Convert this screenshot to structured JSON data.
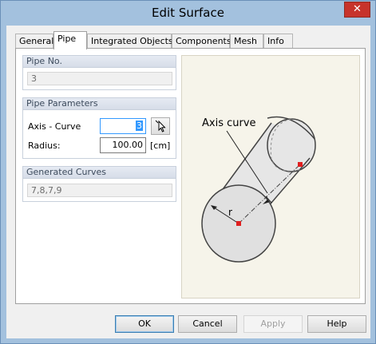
{
  "window": {
    "title": "Edit Surface",
    "close_glyph": "✕"
  },
  "tabs": [
    {
      "label": "General",
      "active": false
    },
    {
      "label": "Pipe",
      "active": true
    },
    {
      "label": "Integrated Objects",
      "active": false
    },
    {
      "label": "Components",
      "active": false
    },
    {
      "label": "Mesh",
      "active": false
    },
    {
      "label": "Info",
      "active": false
    }
  ],
  "pipe_no": {
    "header": "Pipe No.",
    "value": "3"
  },
  "pipe_parameters": {
    "header": "Pipe Parameters",
    "axis_curve_label": "Axis - Curve",
    "axis_curve_value": "3",
    "radius_label": "Radius:",
    "radius_value": "100.00",
    "radius_unit": "[cm]"
  },
  "generated_curves": {
    "header": "Generated Curves",
    "value": "7,8,7,9"
  },
  "illustration": {
    "axis_label": "Axis curve",
    "radius_label": "r",
    "accent_color": "#e02020"
  },
  "buttons": {
    "ok": "OK",
    "cancel": "Cancel",
    "apply": "Apply",
    "help": "Help"
  }
}
